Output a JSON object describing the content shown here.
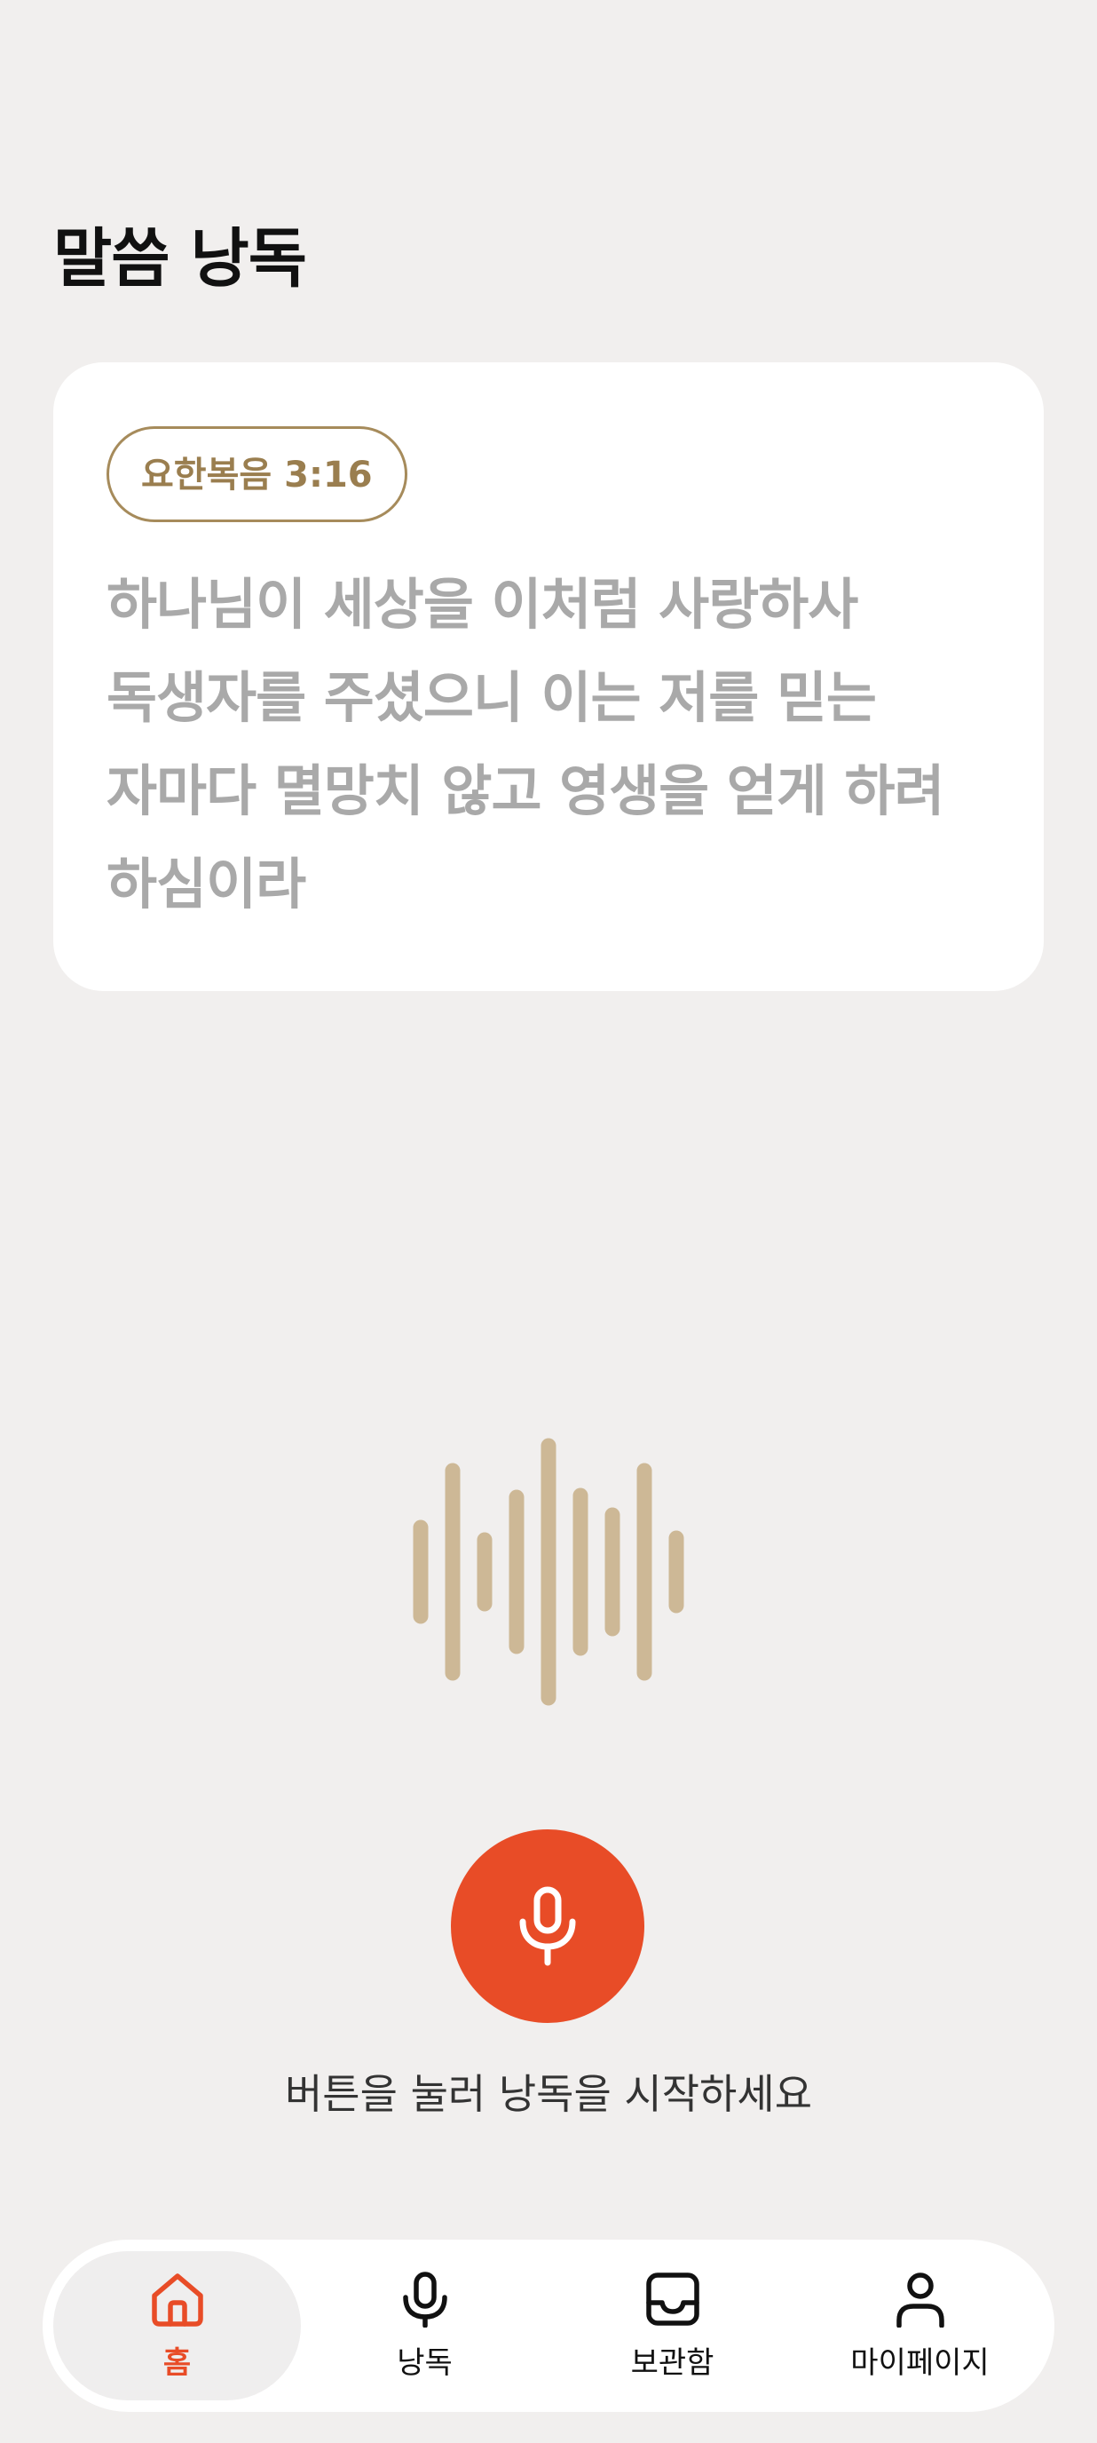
{
  "header": {
    "title": "말씀 낭독"
  },
  "verse": {
    "reference": "요한복음 3:16",
    "text": "하나님이 세상을 이처럼 사랑하사 독생자를 주셨으니 이는 저를 믿는 자마다 멸망치 않고 영생을 얻게 하려 하심이라"
  },
  "waveform": {
    "icon": "waveform-icon",
    "color": "#cdb896"
  },
  "record": {
    "icon": "microphone-icon",
    "color": "#e84c27",
    "hint": "버튼을 눌러 낭독을 시작하세요"
  },
  "nav": {
    "items": [
      {
        "label": "홈",
        "icon": "home-icon",
        "active": true
      },
      {
        "label": "낭독",
        "icon": "microphone-icon",
        "active": false
      },
      {
        "label": "보관함",
        "icon": "inbox-icon",
        "active": false
      },
      {
        "label": "마이페이지",
        "icon": "user-icon",
        "active": false
      }
    ]
  },
  "colors": {
    "background": "#f1efee",
    "accent": "#e84c27",
    "badge": "#a68b5b",
    "verse_text": "#a9a9a9"
  }
}
